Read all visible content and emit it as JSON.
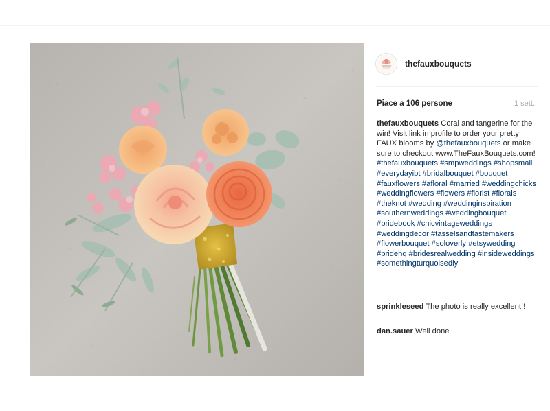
{
  "post": {
    "username": "thefauxbouquets",
    "likes_label": "Piace a 106 persone",
    "time_ago": "1 sett."
  },
  "caption": {
    "author": "thefauxbouquets",
    "text_part1": "Coral and tangerine for the win! Visit link in profile to order your pretty FAUX blooms by ",
    "mention": "@thefauxbouquets",
    "text_part2": " or make sure to checkout www.TheFauxBouquets.com!",
    "hashtags": [
      "#thefauxbouquets",
      "#smpweddings",
      "#shopsmall",
      "#everydayibt",
      "#bridalbouquet",
      "#bouquet",
      "#fauxflowers",
      "#afloral",
      "#married",
      "#weddingchicks",
      "#weddingflowers",
      "#flowers",
      "#florist",
      "#florals",
      "#theknot",
      "#wedding",
      "#weddinginspiration",
      "#southernweddings",
      "#weddingbouquet",
      "#bridebook",
      "#chicvintageweddings",
      "#weddingdecor",
      "#tasselsandtastemakers",
      "#flowerbouquet",
      "#soloverly",
      "#etsywedding",
      "#bridehq",
      "#bridesrealwedding",
      "#insideweddings",
      "#somethingturquoisediy"
    ]
  },
  "comments": [
    {
      "user": "sprinkleseed",
      "text": "The photo is really excellent!!"
    },
    {
      "user": "dan.sauer",
      "text": "Well done"
    }
  ],
  "colors": {
    "hashtag": "#003569",
    "text": "#262626",
    "muted": "#a5a7aa"
  }
}
